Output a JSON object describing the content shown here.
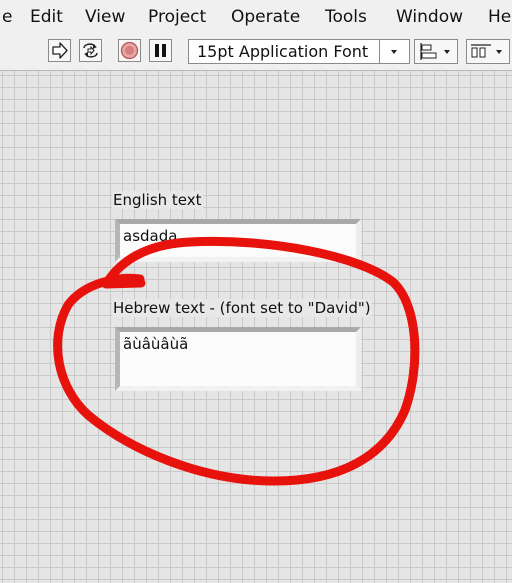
{
  "menubar": {
    "items": [
      "e",
      "Edit",
      "View",
      "Project",
      "Operate",
      "Tools",
      "Window",
      "He"
    ]
  },
  "toolbar": {
    "buttons": [
      {
        "icon": "run-arrow-icon"
      },
      {
        "icon": "run-continuously-icon"
      },
      {
        "icon": "abort-execution-icon"
      },
      {
        "icon": "pause-icon"
      }
    ],
    "font_select": {
      "value": "15pt Application Font"
    },
    "align_button": {
      "icon": "align-objects-icon"
    },
    "distribute_button": {
      "icon": "distribute-objects-icon"
    }
  },
  "front_panel": {
    "english_control": {
      "label": "English text",
      "value": "asdada"
    },
    "hebrew_control": {
      "label": "Hebrew text - (font set to \"David\")",
      "value": "ãùâùâùã"
    }
  },
  "annotation": {
    "color": "#e8120c"
  }
}
